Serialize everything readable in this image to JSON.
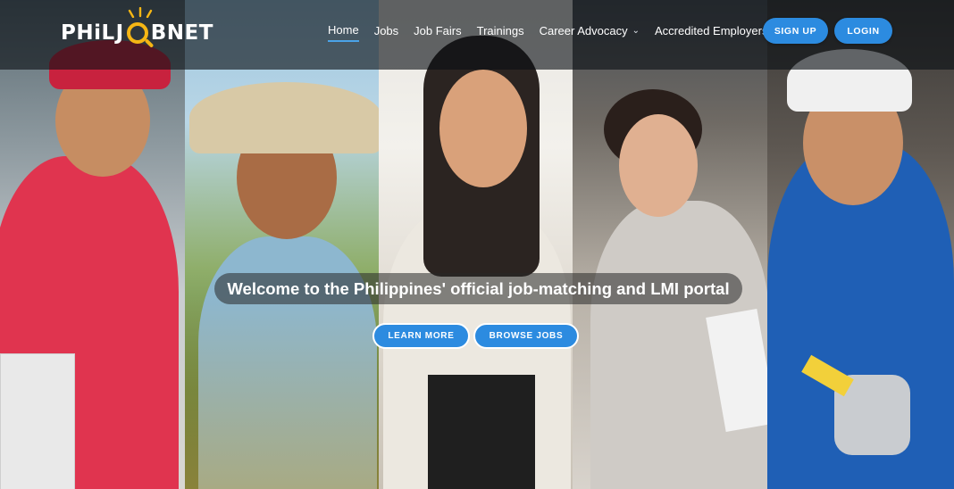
{
  "brand": {
    "logo_text_left": "PHiL",
    "logo_text_mid": "J",
    "logo_text_right": "BNET",
    "accent_color": "#f5b614"
  },
  "nav": {
    "items": [
      {
        "label": "Home",
        "active": true
      },
      {
        "label": "Jobs",
        "active": false
      },
      {
        "label": "Job Fairs",
        "active": false
      },
      {
        "label": "Trainings",
        "active": false
      },
      {
        "label": "Career Advocacy",
        "active": false,
        "has_dropdown": true,
        "icon": "chevron-down-icon"
      },
      {
        "label": "Accredited Employers",
        "active": false
      }
    ],
    "signup_label": "SIGN UP",
    "login_label": "LOGIN",
    "button_color": "#2c8be0"
  },
  "hero": {
    "welcome_text": "Welcome to the Philippines' official job-matching and LMI portal",
    "learn_more_label": "LEARN MORE",
    "browse_jobs_label": "BROWSE JOBS"
  },
  "photos": [
    {
      "subject": "delivery-worker-photo"
    },
    {
      "subject": "farmer-photo"
    },
    {
      "subject": "businesswoman-photo"
    },
    {
      "subject": "office-worker-photo"
    },
    {
      "subject": "mechanic-photo"
    }
  ]
}
